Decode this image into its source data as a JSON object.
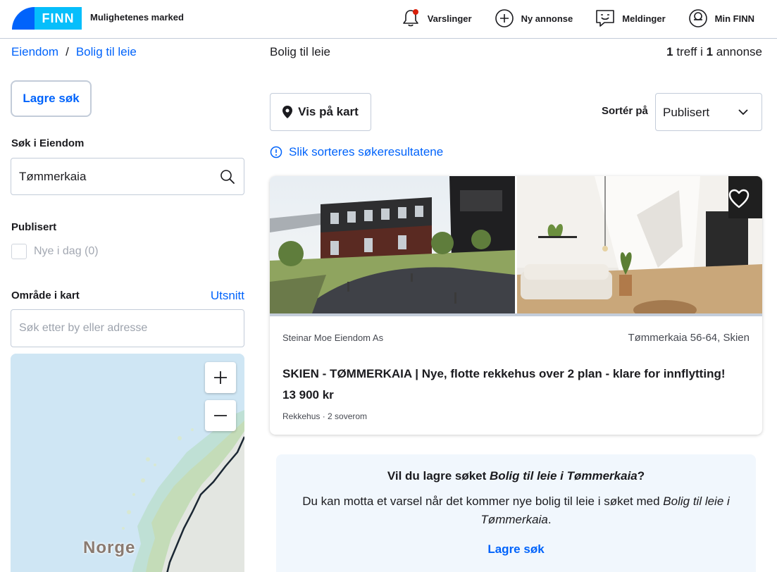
{
  "header": {
    "logo_text": "FINN",
    "tagline": "Mulighetenes marked",
    "nav": [
      {
        "label": "Varslinger",
        "icon": "bell-icon"
      },
      {
        "label": "Ny annonse",
        "icon": "plus-circle-icon"
      },
      {
        "label": "Meldinger",
        "icon": "chat-icon"
      },
      {
        "label": "Min FINN",
        "icon": "user-icon"
      }
    ]
  },
  "breadcrumb": {
    "items": [
      "Eiendom",
      "Bolig til leie"
    ],
    "separator": "/"
  },
  "sidebar": {
    "save_search_label": "Lagre søk",
    "search_label": "Søk i Eiendom",
    "search_value": "Tømmerkaia",
    "published_label": "Publisert",
    "published_option": "Nye i dag (0)",
    "area_label": "Område i kart",
    "area_link": "Utsnitt",
    "address_placeholder": "Søk etter by eller adresse",
    "map_label": "Norge"
  },
  "results": {
    "title": "Bolig til leie",
    "hits_count": "1",
    "hits_mid": " treff i ",
    "ads_count": "1",
    "ads_label": " annonse",
    "show_map_label": "Vis på kart",
    "sort_label": "Sortér på",
    "sort_value": "Publisert",
    "sort_info": "Slik sorteres søkeresultatene"
  },
  "listing": {
    "agent": "Steinar Moe Eiendom As",
    "address": "Tømmerkaia 56-64, Skien",
    "title": "SKIEN - TØMMERKAIA | Nye, flotte rekkehus over 2 plan - klare for innflytting!",
    "price": "13 900 kr",
    "meta": "Rekkehus · 2 soverom"
  },
  "save_prompt": {
    "question_prefix": "Vil du lagre søket ",
    "question_em": "Bolig til leie i Tømmerkaia",
    "question_suffix": "?",
    "description_prefix": "Du kan motta et varsel når det kommer nye bolig til leie i søket med ",
    "description_em": "Bolig til leie i Tømmerkaia",
    "description_suffix": ".",
    "cta": "Lagre søk"
  },
  "colors": {
    "brand_blue": "#0063fb",
    "brand_cyan": "#06befb",
    "notification_dot": "#d91f0a",
    "save_box_bg": "#f1f7fd"
  }
}
